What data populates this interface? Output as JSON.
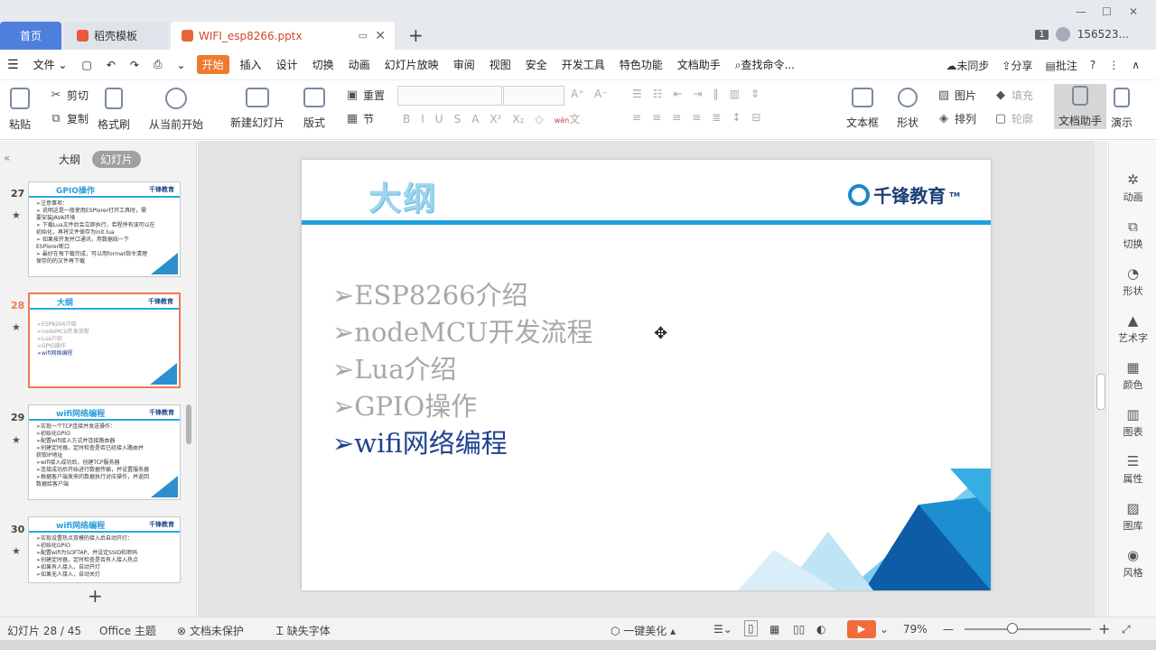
{
  "tabs": {
    "home": "首页",
    "template": "稻壳模板",
    "file": "WIFI_esp8266.pptx"
  },
  "window": {
    "badge": "1",
    "user_id": "156523..."
  },
  "menu": {
    "file": "文件",
    "items": [
      "开始",
      "插入",
      "设计",
      "切换",
      "动画",
      "幻灯片放映",
      "审阅",
      "视图",
      "安全",
      "开发工具",
      "特色功能",
      "文档助手"
    ],
    "search": "查找命令...",
    "sync": "未同步",
    "share": "分享",
    "comment": "批注"
  },
  "ribbon": {
    "paste": "粘贴",
    "cut": "剪切",
    "copy": "复制",
    "format_painter": "格式刷",
    "from_current": "从当前开始",
    "new_slide": "新建幻灯片",
    "layout": "版式",
    "reset": "重置",
    "section": "节",
    "textbox": "文本框",
    "shape": "形状",
    "picture": "图片",
    "arrange": "排列",
    "fill": "填充",
    "outline": "轮廓",
    "doc_assistant": "文档助手",
    "present": "演示",
    "wen": "wén",
    "wen_char": "文"
  },
  "left_panel": {
    "tab_outline": "大纲",
    "tab_slides": "幻灯片",
    "thumbs": [
      {
        "num": "27",
        "title": "GPIO操作",
        "logo": "千锋教育",
        "lines": [
          "➢注意事项：",
          "➢ 说明这是一般使用ESPlorer打开工具时，需",
          "  要安装JAVA环境",
          "➢ 下载Lua文件后会立即执行，若程序有误可以在",
          "  初始化，再将文件保存为init.lua",
          "➢ 如果按开发并口通讯，用数据线一下",
          "  ESPlorer断口",
          "➢ 最好在每下载完成，可以用format指令清理",
          "  保存的的文件再下载"
        ]
      },
      {
        "num": "28",
        "title": "大纲",
        "logo": "千锋教育",
        "lines": [
          "➢ESP8266介绍",
          "➢nodeMCU开发流程",
          "➢Lua介绍",
          "➢GPIO操作",
          "➢wifi网络编程"
        ]
      },
      {
        "num": "29",
        "title": "wifi网络编程",
        "logo": "千锋教育",
        "lines": [
          "➢实现一个TCP连接并发送操作：",
          "  ➢初始化GPIO",
          "  ➢配置wifi接入方式并连接路由器",
          "  ➢创建定时器，定时检查是否已经接入路由并",
          "    获取IP地址",
          "  ➢wifi接入成功后，创建TCP服务器",
          "  ➢连接成功后开始进行数据传输，并设置服务器",
          "  ➢根据客户端发来的数据执行对应操作，并返回",
          "    数据给客户端"
        ]
      },
      {
        "num": "30",
        "title": "wifi网络编程",
        "logo": "千锋教育",
        "lines": [
          "➢实现设置热点双模的接入后自动开灯：",
          "  ➢初始化GPIO",
          "  ➢配置wifi为SOFTAP，并设定SSID和密码",
          "  ➢创建定时器，定时检查是否有人接入热点",
          "  ➢如果有人接入，自动开灯",
          "  ➢如果无人接入，自动关灯"
        ]
      }
    ]
  },
  "slide": {
    "title": "大纲",
    "logo_text": "千锋教育",
    "tm": "TM",
    "bullets": [
      "➢ESP8266介绍",
      "➢nodeMCU开发流程",
      "➢Lua介绍",
      "➢GPIO操作",
      "➢wifi网络编程"
    ]
  },
  "right_panel": [
    "动画",
    "切换",
    "形状",
    "艺术字",
    "颜色",
    "图表",
    "属性",
    "图库",
    "风格"
  ],
  "status": {
    "slide_pos": "幻灯片 28 / 45",
    "theme": "Office 主题",
    "protect": "文档未保护",
    "font_missing": "缺失字体",
    "beautify": "一键美化",
    "zoom": "79%"
  }
}
